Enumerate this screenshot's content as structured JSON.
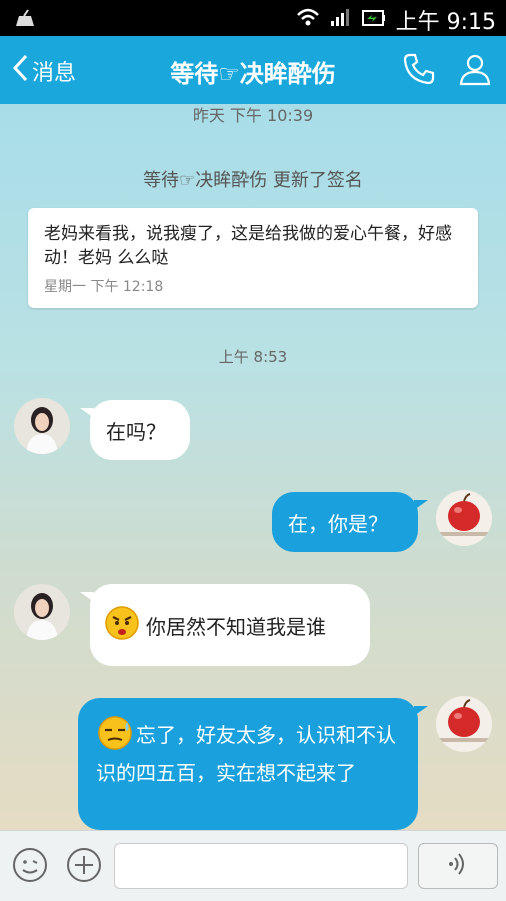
{
  "status_bar": {
    "time": "上午 9:15"
  },
  "navbar": {
    "back_label": "消息",
    "title": "等待☞决眸酔伤"
  },
  "chat": {
    "top_time": "昨天 下午 10:39",
    "system_message": "等待☞决眸酔伤 更新了签名",
    "signature_card": {
      "text": "老妈来看我，说我瘦了，这是给我做的爱心午餐，好感动！老妈 么么哒",
      "time": "星期一 下午 12:18"
    },
    "time_divider": "上午 8:53",
    "messages": [
      {
        "side": "in",
        "text": "在吗？"
      },
      {
        "side": "out",
        "text": "在，你是？"
      },
      {
        "side": "in",
        "text": "你居然不知道我是谁",
        "emoji": "angry-face"
      },
      {
        "side": "out",
        "text": "忘了，好友太多，认识和不认识的四五百，实在想不起来了",
        "emoji": "sweat-face"
      }
    ]
  },
  "input_bar": {
    "placeholder": ""
  },
  "colors": {
    "accent": "#1aa8dc",
    "outgoing_bubble": "#1aa0dc"
  }
}
